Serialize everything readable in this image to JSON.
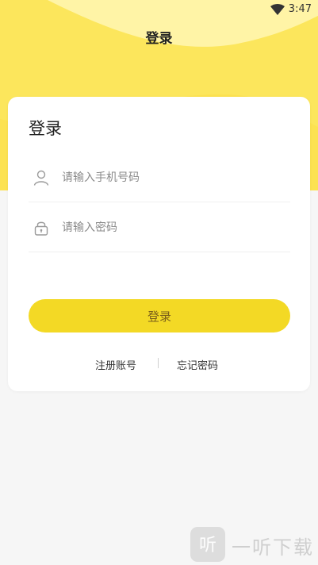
{
  "status_bar": {
    "time": "3:47",
    "wifi_icon": "wifi-icon"
  },
  "header": {
    "title": "登录",
    "background_color": "#fce65c"
  },
  "card": {
    "title": "登录",
    "phone_field": {
      "placeholder": "请输入手机号码",
      "value": "",
      "icon": "user-icon"
    },
    "password_field": {
      "placeholder": "请输入密码",
      "value": "",
      "icon": "lock-icon"
    },
    "login_button": {
      "label": "登录",
      "color": "#f3d925"
    },
    "links": {
      "register": "注册账号",
      "forgot_password": "忘记密码"
    }
  },
  "watermark": {
    "text": "一听下载",
    "logo_glyph": "听"
  }
}
